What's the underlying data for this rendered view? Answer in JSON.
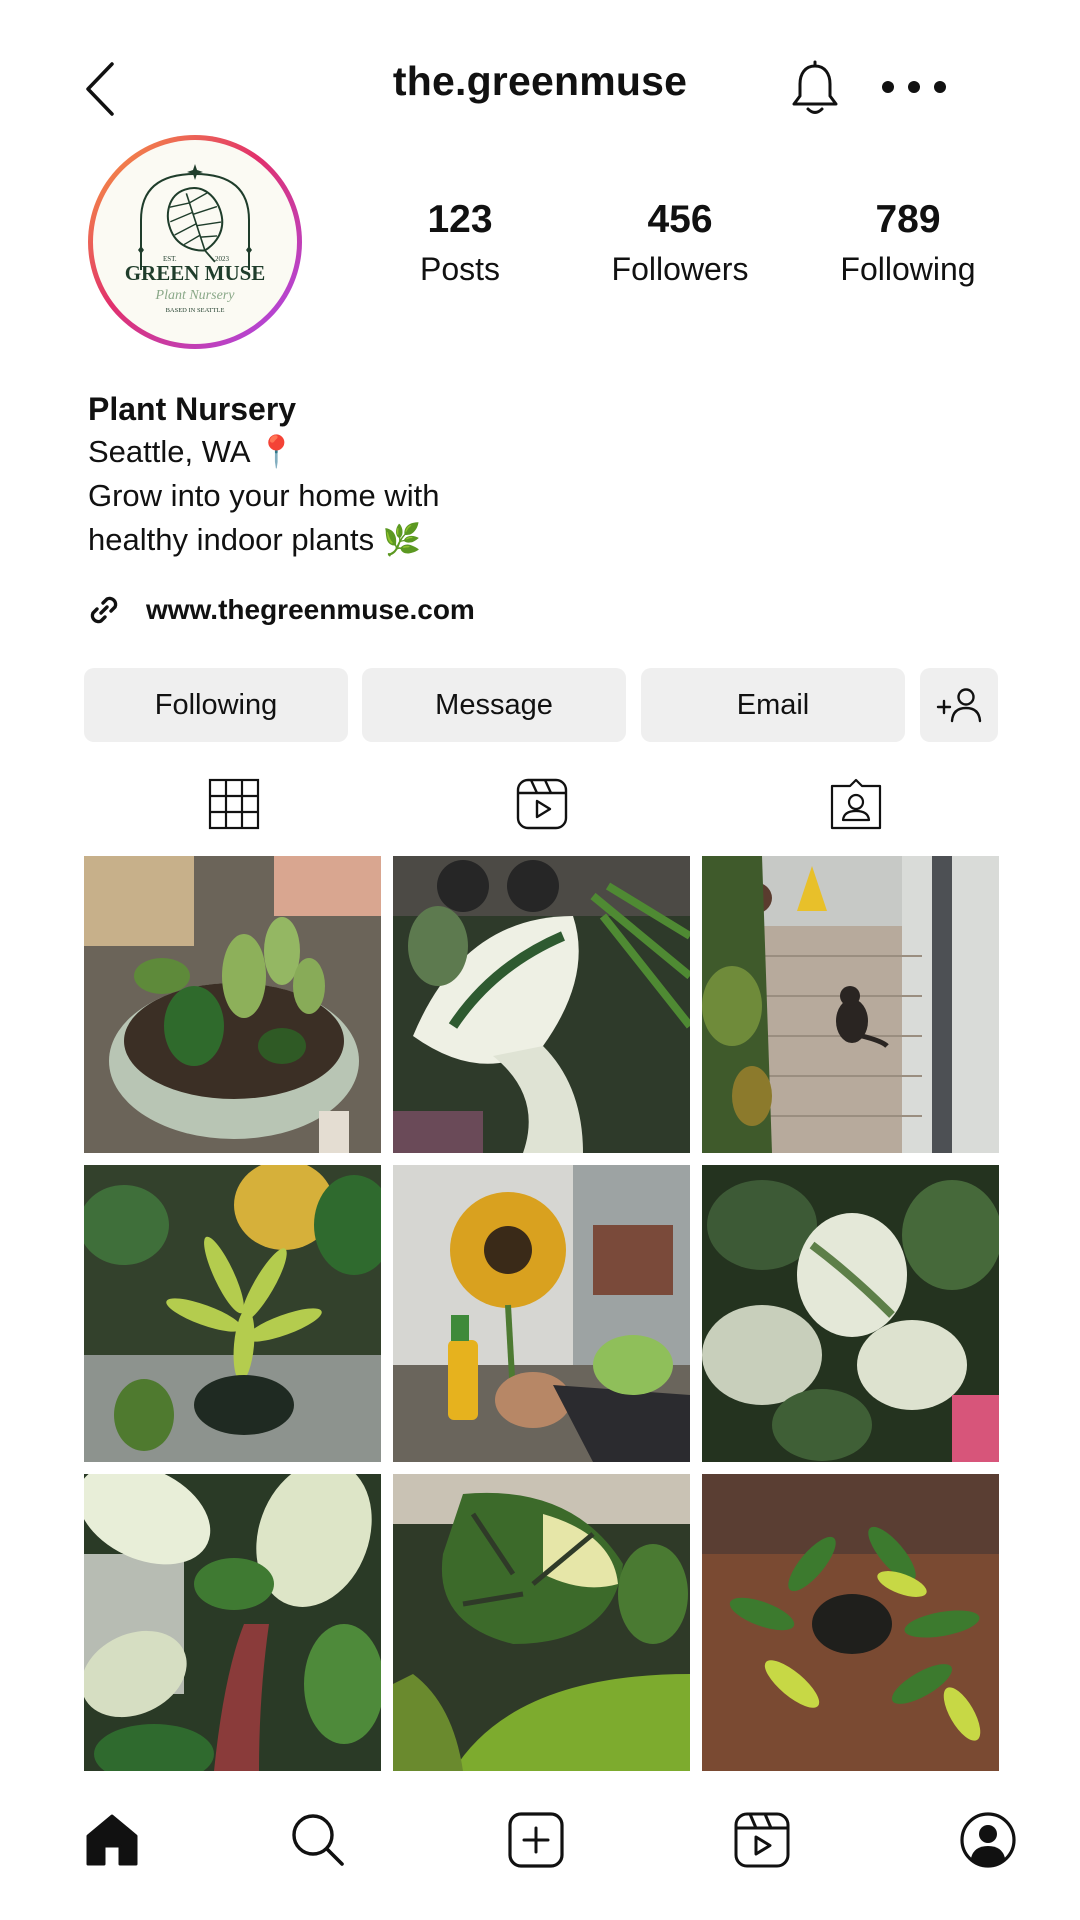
{
  "header": {
    "username": "the.greenmuse"
  },
  "profile": {
    "logo_text": {
      "est": "EST.",
      "year": "2023",
      "name": "GREEN MUSE",
      "script": "Plant Nursery",
      "tagline": "BASED IN SEATTLE"
    },
    "stats": [
      {
        "value": "123",
        "label": "Posts"
      },
      {
        "value": "456",
        "label": "Followers"
      },
      {
        "value": "789",
        "label": "Following"
      }
    ],
    "bio": {
      "name": "Plant Nursery",
      "location": "Seattle, WA 📍",
      "line1": "Grow into your home with",
      "line2": "healthy indoor plants 🌿"
    },
    "website": "www.thegreenmuse.com"
  },
  "actions": {
    "following": "Following",
    "message": "Message",
    "email": "Email"
  },
  "colors": {
    "button_bg": "#efefef",
    "ring_gradient": [
      "#f9a23b",
      "#e1306c",
      "#a64bf4"
    ],
    "logo_green": "#1f3d2b"
  },
  "icons": {
    "back": "chevron-left-icon",
    "bell": "bell-icon",
    "more": "more-horizontal-icon",
    "link": "link-icon",
    "add_user": "add-user-icon",
    "grid": "grid-icon",
    "reels": "reels-icon",
    "tagged": "tagged-icon",
    "home": "home-icon",
    "search": "search-icon",
    "create": "create-icon",
    "profile": "profile-icon"
  }
}
